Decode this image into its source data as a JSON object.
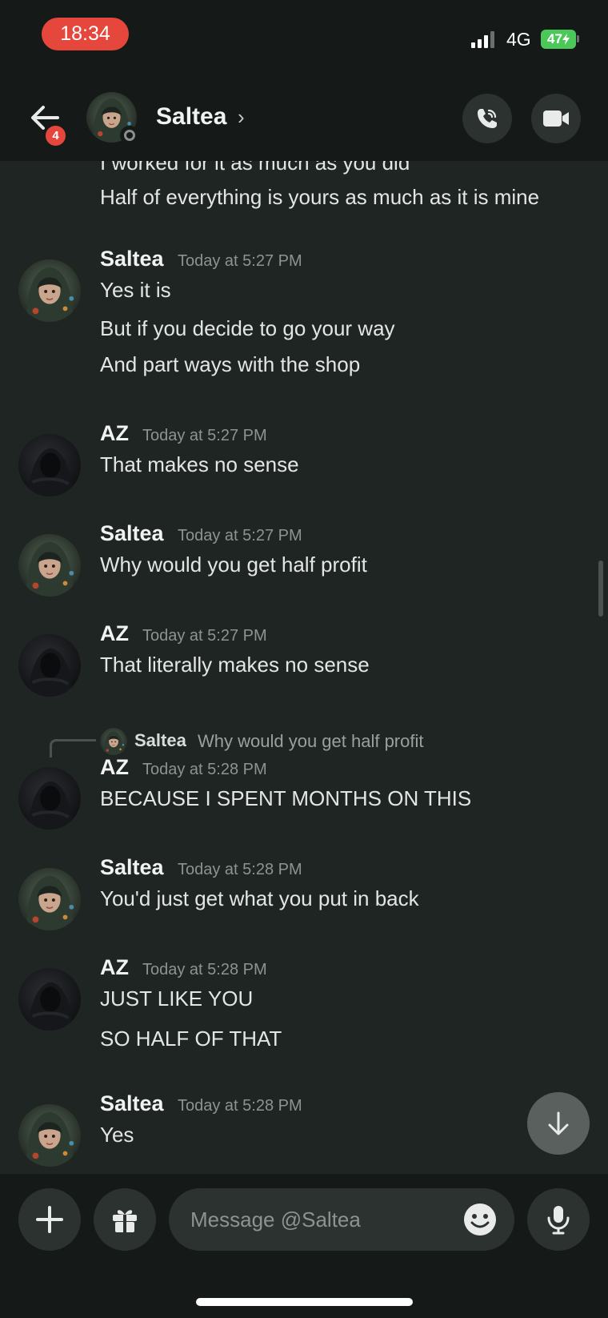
{
  "status_bar": {
    "time": "18:34",
    "network": "4G",
    "battery": "47"
  },
  "header": {
    "contact_name": "Saltea",
    "chevron": "›",
    "back_badge": "4",
    "icons": {
      "back": "arrow-left-icon",
      "call": "phone-call-icon",
      "video": "video-camera-icon"
    }
  },
  "messages": {
    "partial": {
      "lines": [
        "I worked for it as much as you did",
        "Half of everything is yours as much as it is mine"
      ]
    },
    "m1": {
      "author": "Saltea",
      "timestamp": "Today at 5:27 PM",
      "lines": [
        "Yes it is",
        "But if you decide to go your way",
        "And part ways with the shop"
      ]
    },
    "m2": {
      "author": "AZ",
      "timestamp": "Today at 5:27 PM",
      "lines": [
        "That makes no sense"
      ]
    },
    "m3": {
      "author": "Saltea",
      "timestamp": "Today at 5:27 PM",
      "lines": [
        "Why would you get half profit"
      ]
    },
    "m4": {
      "author": "AZ",
      "timestamp": "Today at 5:27 PM",
      "lines": [
        "That literally makes no sense"
      ]
    },
    "m5": {
      "reply": {
        "author": "Saltea",
        "text": "Why would you get half profit"
      },
      "author": "AZ",
      "timestamp": "Today at 5:28 PM",
      "lines": [
        "BECAUSE I SPENT MONTHS ON THIS"
      ]
    },
    "m6": {
      "author": "Saltea",
      "timestamp": "Today at 5:28 PM",
      "lines": [
        "You'd just get what you put in back"
      ]
    },
    "m7": {
      "author": "AZ",
      "timestamp": "Today at 5:28 PM",
      "lines": [
        "JUST LIKE YOU",
        "SO HALF OF THAT"
      ]
    },
    "m8": {
      "author": "Saltea",
      "timestamp": "Today at 5:28 PM",
      "lines": [
        "Yes"
      ]
    }
  },
  "composer": {
    "placeholder": "Message @Saltea",
    "value": "",
    "icons": {
      "attach": "plus-icon",
      "gift": "gift-icon",
      "emoji": "emoji-icon",
      "mic": "microphone-icon",
      "jump": "arrow-down-icon"
    }
  },
  "colors": {
    "background": "#1f2523",
    "bar": "#151918",
    "button": "#2b3230",
    "accent_red": "#e5473c",
    "battery_green": "#4cc85b"
  }
}
